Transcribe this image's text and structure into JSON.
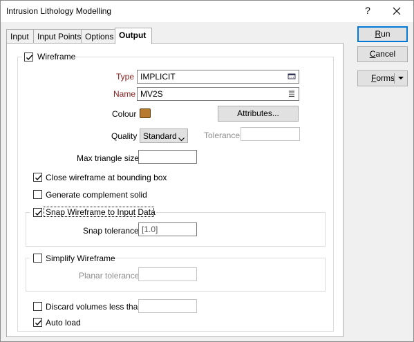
{
  "window": {
    "title": "Intrusion Lithology Modelling",
    "help_label": "?"
  },
  "tabs": [
    {
      "label": "Input"
    },
    {
      "label": "Input Points"
    },
    {
      "label": "Options"
    },
    {
      "label": "Output",
      "active": true
    }
  ],
  "side_buttons": {
    "run": {
      "pre": "",
      "u": "R",
      "post": "un"
    },
    "cancel": {
      "pre": "",
      "u": "C",
      "post": "ancel"
    },
    "forms": {
      "pre": "",
      "u": "F",
      "post": "orms"
    }
  },
  "output": {
    "wireframe": {
      "label": "Wireframe",
      "checked": true
    },
    "type": {
      "label": "Type",
      "value": "IMPLICIT"
    },
    "name": {
      "label": "Name",
      "value": "MV2S"
    },
    "colour": {
      "label": "Colour",
      "value": "#b87a2e"
    },
    "attributes_button": "Attributes...",
    "quality": {
      "label": "Quality",
      "value": "Standard"
    },
    "tolerance": {
      "label": "Tolerance",
      "value": ""
    },
    "max_triangle_size": {
      "label": "Max triangle size",
      "value": ""
    },
    "close_wireframe": {
      "label": "Close wireframe at bounding box",
      "checked": true
    },
    "generate_complement": {
      "label": "Generate complement solid",
      "checked": false
    },
    "snap_wireframe": {
      "label": "Snap Wireframe to Input Data",
      "checked": true
    },
    "snap_tolerance": {
      "label": "Snap tolerance",
      "value": "[1.0]"
    },
    "simplify_wireframe": {
      "label": "Simplify Wireframe",
      "checked": false
    },
    "planar_tolerance": {
      "label": "Planar tolerance",
      "value": ""
    },
    "discard_volumes": {
      "label": "Discard volumes less than",
      "checked": false,
      "value": ""
    },
    "auto_load": {
      "label": "Auto load",
      "checked": true
    }
  }
}
